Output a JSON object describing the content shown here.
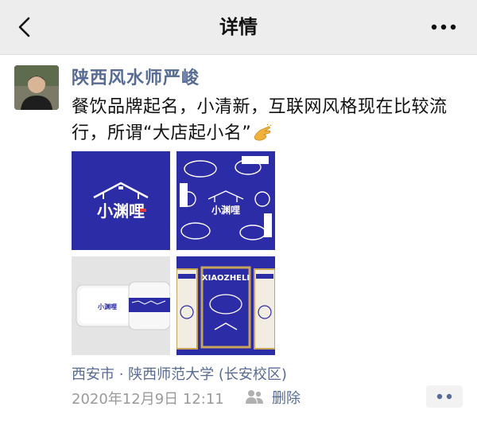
{
  "header": {
    "title": "详情",
    "back_icon": "chevron-left-icon",
    "more_icon": "more-icon"
  },
  "post": {
    "author": "陕西风水师严峻",
    "text": "餐饮品牌起名，小清新，互联网风格现在比较流行，所谓“大店起小名”",
    "emoji": "clapping-hands-icon",
    "photos": [
      {
        "logo": "小渊哩"
      },
      {
        "logo": "小渊哩"
      },
      {
        "logo": "小渊哩"
      },
      {
        "poster_text": "XIAOZHELI"
      }
    ],
    "location": "西安市 · 陕西师范大学 (长安校区)",
    "timestamp": "2020年12月9日 12:11",
    "delete_label": "删除"
  },
  "colors": {
    "link": "#576b95",
    "brand_blue": "#2d2ca7",
    "header_bg": "#ededed"
  }
}
